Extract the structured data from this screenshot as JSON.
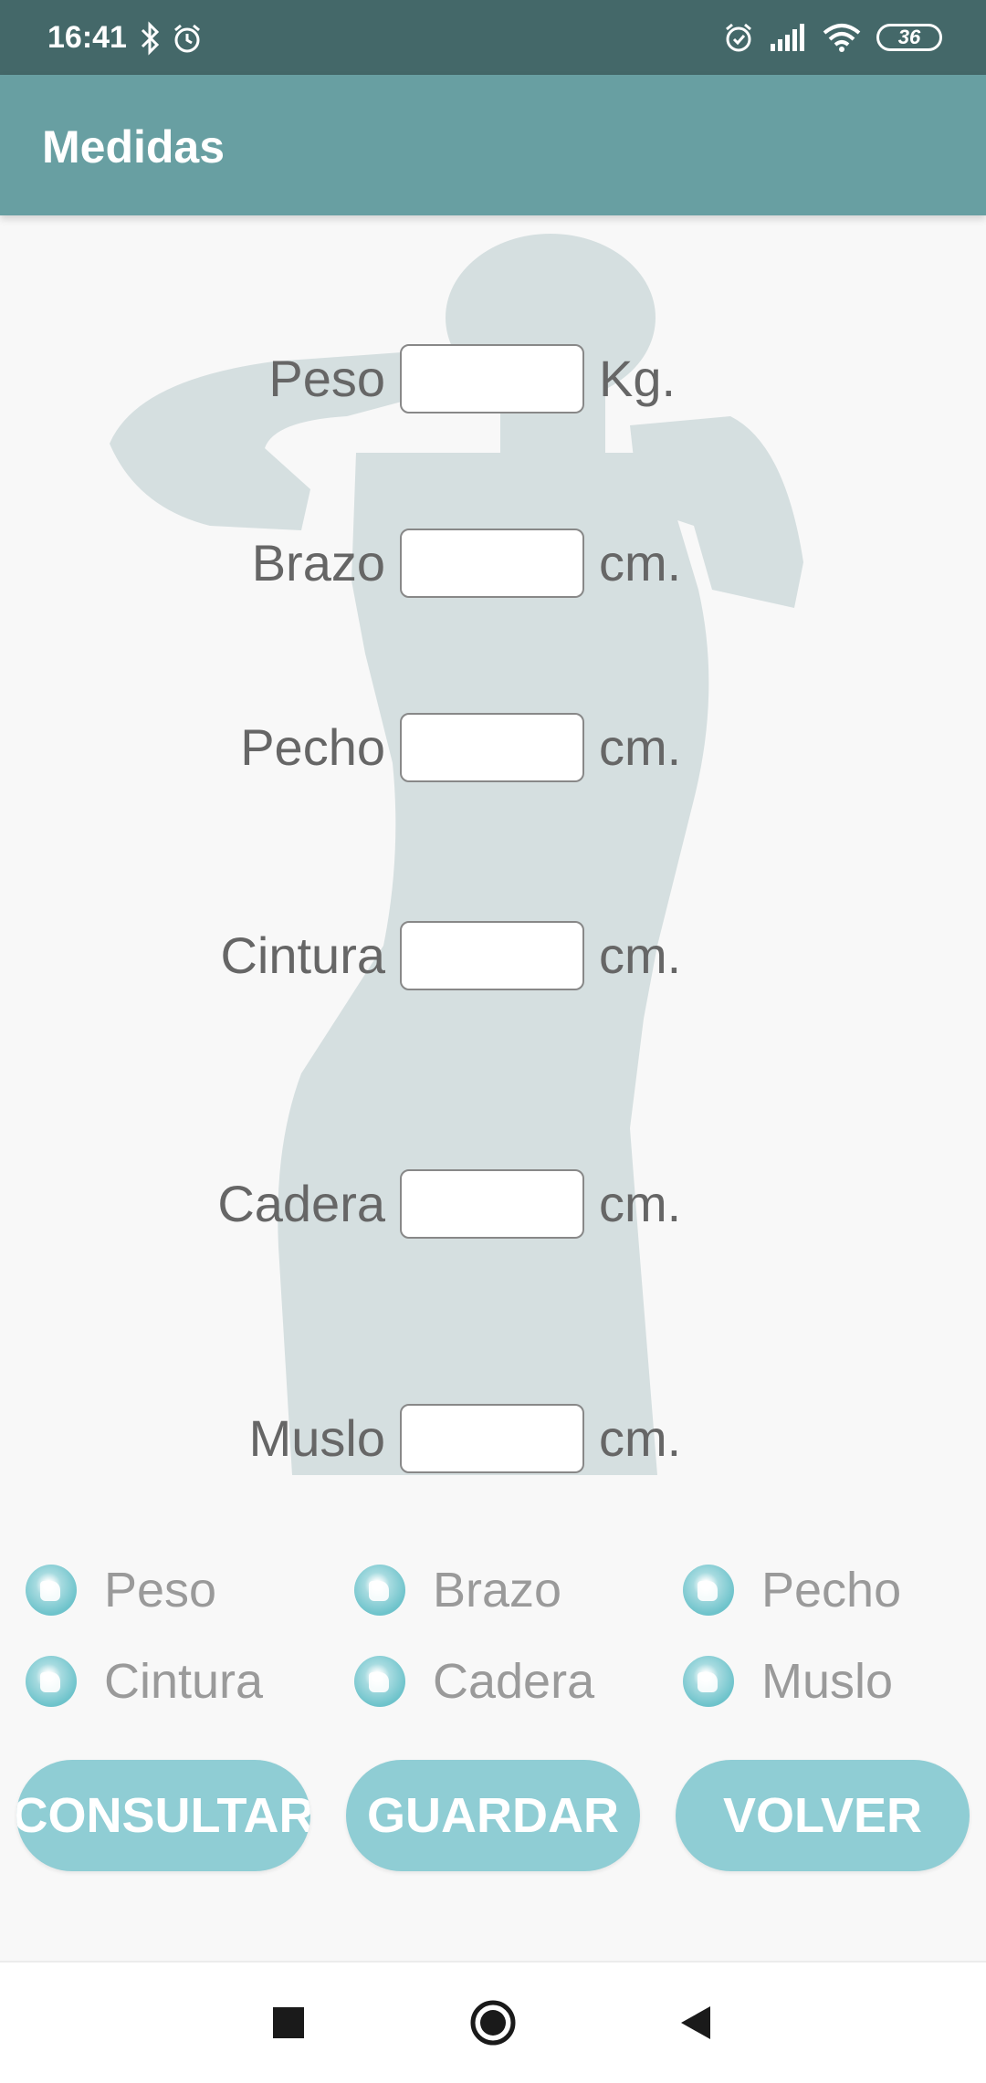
{
  "status_bar": {
    "time": "16:41",
    "left_icons": [
      "bluetooth-icon",
      "alarm-icon"
    ],
    "right_icons": [
      "alarm-icon",
      "signal-icon",
      "wifi-icon"
    ],
    "battery": "36"
  },
  "app_bar": {
    "title": "Medidas"
  },
  "form": {
    "rows": [
      {
        "label": "Peso",
        "unit": "Kg.",
        "value": ""
      },
      {
        "label": "Brazo",
        "unit": "cm.",
        "value": ""
      },
      {
        "label": "Pecho",
        "unit": "cm.",
        "value": ""
      },
      {
        "label": "Cintura",
        "unit": "cm.",
        "value": ""
      },
      {
        "label": "Cadera",
        "unit": "cm.",
        "value": ""
      },
      {
        "label": "Muslo",
        "unit": "cm.",
        "value": ""
      }
    ]
  },
  "radio_options": [
    "Peso",
    "Brazo",
    "Pecho",
    "Cintura",
    "Cadera",
    "Muslo"
  ],
  "buttons": {
    "consultar": "CONSULTAR",
    "guardar": "GUARDAR",
    "volver": "VOLVER"
  },
  "nav": [
    "square-recents-icon",
    "circle-home-icon",
    "triangle-back-icon"
  ],
  "colors": {
    "status_bar": "#446869",
    "app_bar": "#689fa2",
    "button": "#8fcdd4",
    "silhouette": "#d5dfe0",
    "label_text": "#666666",
    "radio_text": "#9a9a9a"
  }
}
